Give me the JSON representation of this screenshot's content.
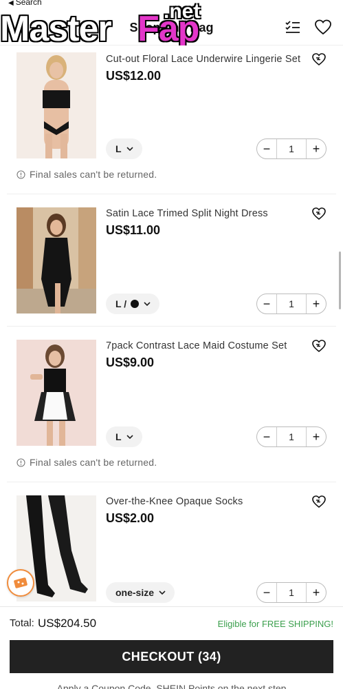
{
  "status_bar": {
    "back_label": "Search"
  },
  "header": {
    "title": "Shopping Bag"
  },
  "watermark": {
    "text_a": "Master",
    "text_b": "Fap",
    "text_c": ".net"
  },
  "items": [
    {
      "name": "Cut-out Floral Lace Underwire Lingerie Set",
      "price": "US$12.00",
      "variant": "L",
      "quantity": "1",
      "note": "Final sales can't be returned."
    },
    {
      "name": "Satin Lace Trimed Split Night Dress",
      "price": "US$11.00",
      "variant": "L /",
      "variant_color": "#111111",
      "quantity": "1"
    },
    {
      "name": "7pack Contrast Lace Maid Costume Set",
      "price": "US$9.00",
      "variant": "L",
      "quantity": "1",
      "note": "Final sales can't be returned."
    },
    {
      "name": "Over-the-Knee Opaque Socks",
      "price": "US$2.00",
      "variant": "one-size",
      "quantity": "1"
    }
  ],
  "stepper": {
    "minus": "−",
    "plus": "+"
  },
  "footer": {
    "total_label": "Total:",
    "total_value": "US$204.50",
    "shipping_note": "Eligible for FREE SHIPPING!",
    "checkout_label": "CHECKOUT (34)",
    "coupon_note": "Apply a Coupon Code, SHEIN Points on the next step"
  },
  "colors": {
    "accent_dark": "#222222",
    "shipping_green": "#3b9f4d",
    "badge_orange": "#f08c3c"
  },
  "icons": [
    "list-check-icon",
    "wishlist-heart-icon",
    "add-to-wishlist-icon",
    "info-icon",
    "chevron-down-icon",
    "coupon-badge-icon"
  ]
}
